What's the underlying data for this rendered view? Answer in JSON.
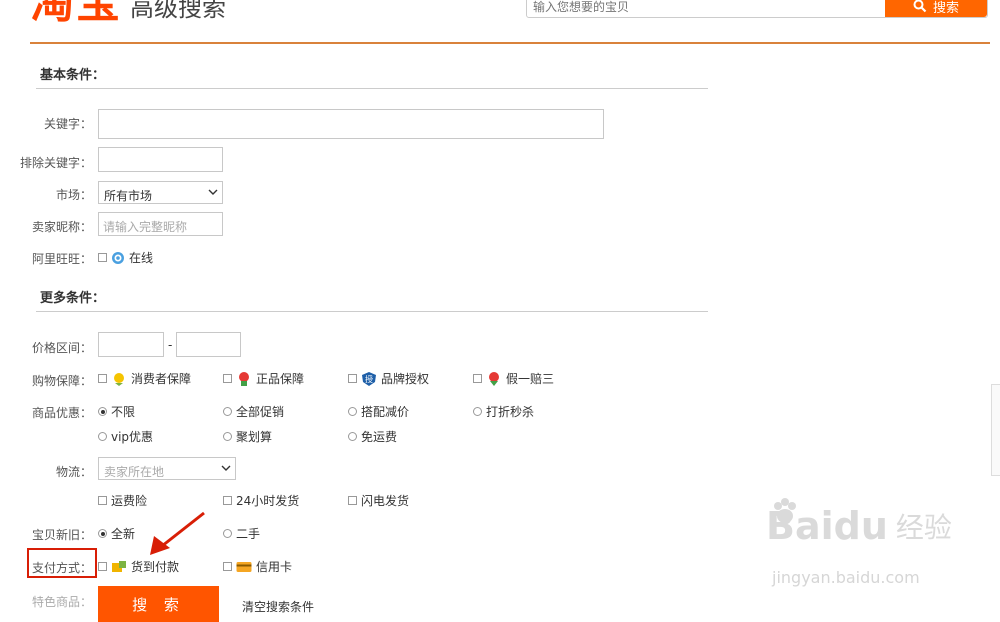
{
  "header": {
    "logo_text": "淘宝",
    "title": "高级搜索",
    "search_placeholder": "输入您想要的宝贝",
    "search_button": "搜索"
  },
  "basic": {
    "title": "基本条件：",
    "keyword_label": "关键字：",
    "exclude_label": "排除关键字：",
    "market_label": "市场：",
    "market_value": "所有市场",
    "seller_label": "卖家昵称：",
    "seller_placeholder": "请输入完整昵称",
    "wangwang_label": "阿里旺旺：",
    "wangwang_option": "在线"
  },
  "more": {
    "title": "更多条件：",
    "price_label": "价格区间：",
    "price_sep": "-",
    "guarantee_label": "购物保障：",
    "guarantees": [
      "消费者保障",
      "正品保障",
      "品牌授权",
      "假一赔三"
    ],
    "promo_label": "商品优惠：",
    "promos_row1": [
      "不限",
      "全部促销",
      "搭配减价",
      "打折秒杀"
    ],
    "promos_row2": [
      "vip优惠",
      "聚划算",
      "免运费"
    ],
    "logistics_label": "物流：",
    "logistics_value": "卖家所在地",
    "logistics_options": [
      "运费险",
      "24小时发货",
      "闪电发货"
    ],
    "condition_label": "宝贝新旧：",
    "conditions": [
      "全新",
      "二手"
    ],
    "payment_label": "支付方式：",
    "payments": [
      "货到付款",
      "信用卡"
    ],
    "special_label": "特色商品：",
    "search_button": "搜 索",
    "clear_link": "清空搜索条件"
  },
  "watermark": {
    "brand": "Baidu",
    "brand_cn": "经验",
    "url": "jingyan.baidu.com"
  },
  "colors": {
    "accent": "#ff5500",
    "header_line": "#d9823b",
    "highlight_box": "#d81e06"
  }
}
